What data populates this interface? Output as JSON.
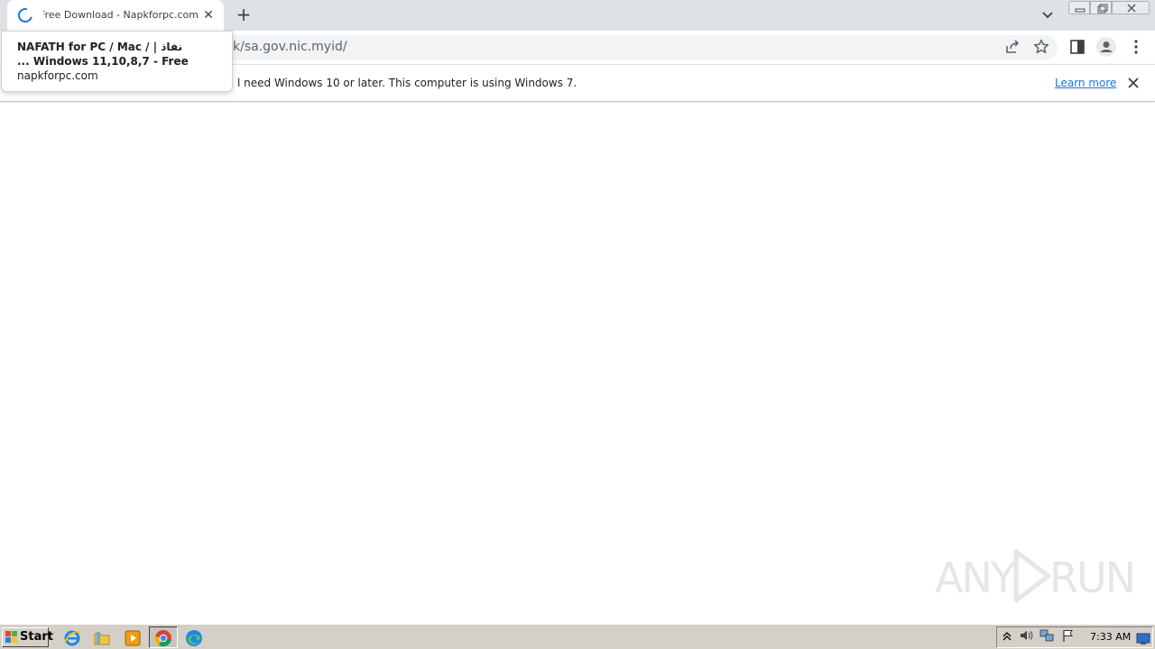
{
  "browser": {
    "tab": {
      "title": "NAFATH for PC / Mac / Windows 11,10,8,7 - Free Download - Napkforpc.com | نفاذ",
      "close_glyph": "✕"
    },
    "new_tab_glyph": "+",
    "address_bar": {
      "url_visible": "k/sa.gov.nic.myid/"
    },
    "toolbar_icons": [
      "share-icon",
      "bookmark-star-icon",
      "side-panel-icon",
      "profile-icon",
      "menu-kebab-icon"
    ],
    "window_controls": [
      "minimize",
      "restore",
      "close"
    ]
  },
  "hover_card": {
    "title_line1": "NAFATH for PC / Mac /  | نفاذ",
    "title_line2": "... Windows 11,10,8,7 - Free",
    "domain": "napkforpc.com"
  },
  "infobar": {
    "message": "l need Windows 10 or later. This computer is using Windows 7.",
    "link": "Learn more"
  },
  "watermark": {
    "left": "ANY",
    "right": "RUN"
  },
  "taskbar": {
    "start_label": "Start",
    "pinned": [
      "internet-explorer-icon",
      "file-explorer-icon",
      "media-player-icon",
      "chrome-icon",
      "edge-icon"
    ],
    "tray_icons": [
      "show-hidden-icon",
      "volume-icon",
      "network-icon",
      "action-center-flag-icon"
    ],
    "clock": "7:33 AM"
  },
  "colors": {
    "tabstrip": "#dee1e6",
    "accent": "#1a73e8",
    "taskbar": "#d4d0c8"
  }
}
